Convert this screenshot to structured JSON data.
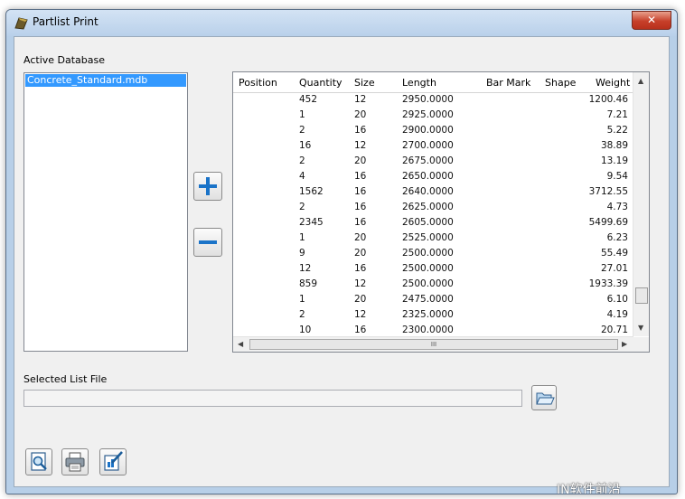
{
  "window": {
    "title": "Partlist Print",
    "close_glyph": "✕"
  },
  "active_database": {
    "label": "Active Database",
    "items": [
      "Concrete_Standard.mdb"
    ]
  },
  "grid": {
    "columns": [
      "Position",
      "Quantity",
      "Size",
      "Length",
      "Bar Mark",
      "Shape",
      "Weight"
    ],
    "rows": [
      {
        "position": "",
        "quantity": "452",
        "size": "12",
        "length": "2950.0000",
        "bar_mark": "",
        "shape": "",
        "weight": "1200.46"
      },
      {
        "position": "",
        "quantity": "1",
        "size": "20",
        "length": "2925.0000",
        "bar_mark": "",
        "shape": "",
        "weight": "7.21"
      },
      {
        "position": "",
        "quantity": "2",
        "size": "16",
        "length": "2900.0000",
        "bar_mark": "",
        "shape": "",
        "weight": "5.22"
      },
      {
        "position": "",
        "quantity": "16",
        "size": "12",
        "length": "2700.0000",
        "bar_mark": "",
        "shape": "",
        "weight": "38.89"
      },
      {
        "position": "",
        "quantity": "2",
        "size": "20",
        "length": "2675.0000",
        "bar_mark": "",
        "shape": "",
        "weight": "13.19"
      },
      {
        "position": "",
        "quantity": "4",
        "size": "16",
        "length": "2650.0000",
        "bar_mark": "",
        "shape": "",
        "weight": "9.54"
      },
      {
        "position": "",
        "quantity": "1562",
        "size": "16",
        "length": "2640.0000",
        "bar_mark": "",
        "shape": "",
        "weight": "3712.55"
      },
      {
        "position": "",
        "quantity": "2",
        "size": "16",
        "length": "2625.0000",
        "bar_mark": "",
        "shape": "",
        "weight": "4.73"
      },
      {
        "position": "",
        "quantity": "2345",
        "size": "16",
        "length": "2605.0000",
        "bar_mark": "",
        "shape": "",
        "weight": "5499.69"
      },
      {
        "position": "",
        "quantity": "1",
        "size": "20",
        "length": "2525.0000",
        "bar_mark": "",
        "shape": "",
        "weight": "6.23"
      },
      {
        "position": "",
        "quantity": "9",
        "size": "20",
        "length": "2500.0000",
        "bar_mark": "",
        "shape": "",
        "weight": "55.49"
      },
      {
        "position": "",
        "quantity": "12",
        "size": "16",
        "length": "2500.0000",
        "bar_mark": "",
        "shape": "",
        "weight": "27.01"
      },
      {
        "position": "",
        "quantity": "859",
        "size": "12",
        "length": "2500.0000",
        "bar_mark": "",
        "shape": "",
        "weight": "1933.39"
      },
      {
        "position": "",
        "quantity": "1",
        "size": "20",
        "length": "2475.0000",
        "bar_mark": "",
        "shape": "",
        "weight": "6.10"
      },
      {
        "position": "",
        "quantity": "2",
        "size": "12",
        "length": "2325.0000",
        "bar_mark": "",
        "shape": "",
        "weight": "4.19"
      },
      {
        "position": "",
        "quantity": "10",
        "size": "16",
        "length": "2300.0000",
        "bar_mark": "",
        "shape": "",
        "weight": "20.71"
      }
    ],
    "hscroll_grip": "III"
  },
  "selected_list_file": {
    "label": "Selected List File",
    "value": ""
  },
  "buttons": {
    "add_icon": "plus-icon",
    "remove_icon": "minus-icon",
    "browse_icon": "folder-icon",
    "preview_icon": "print-preview-icon",
    "print_icon": "printer-icon",
    "edit_icon": "edit-icon"
  },
  "watermark": "IN软件前沿",
  "colors": {
    "selection": "#3399ff",
    "titlebar": "#c4d9ef",
    "close": "#c7402a",
    "accent_blue": "#1a73c8"
  }
}
